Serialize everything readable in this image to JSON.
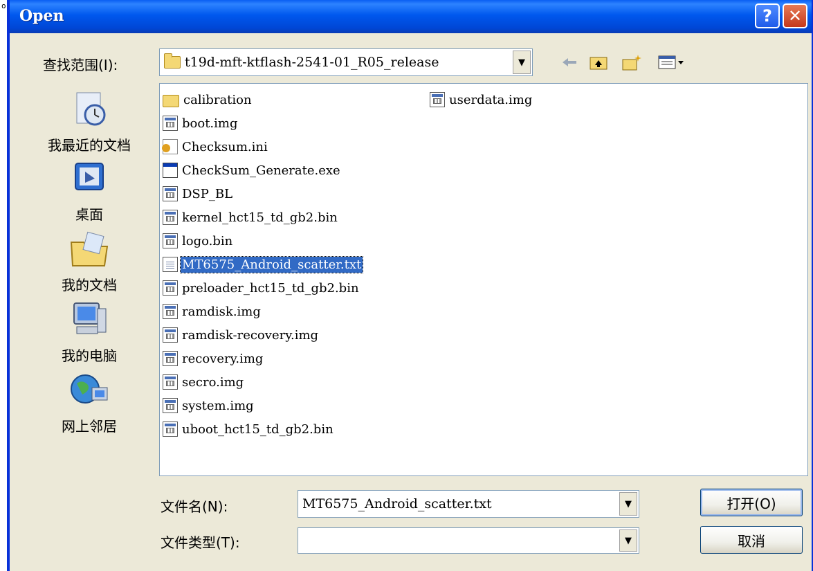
{
  "window": {
    "title": "Open",
    "help_glyph": "?",
    "close_glyph": "✕"
  },
  "lookin": {
    "label": "查找范围(I):",
    "value": "t19d-mft-ktflash-2541-01_R05_release"
  },
  "toolbar": {
    "back": "back-icon",
    "up": "up-folder-icon",
    "new": "new-folder-icon",
    "views": "views-menu-icon"
  },
  "places": [
    {
      "label": "我最近的文档",
      "icon": "recent-documents-icon"
    },
    {
      "label": "桌面",
      "icon": "desktop-icon"
    },
    {
      "label": "我的文档",
      "icon": "my-documents-icon"
    },
    {
      "label": "我的电脑",
      "icon": "my-computer-icon"
    },
    {
      "label": "网上邻居",
      "icon": "network-places-icon"
    }
  ],
  "files": [
    {
      "name": "calibration",
      "type": "folder"
    },
    {
      "name": "boot.img",
      "type": "img"
    },
    {
      "name": "Checksum.ini",
      "type": "ini"
    },
    {
      "name": "CheckSum_Generate.exe",
      "type": "exe"
    },
    {
      "name": "DSP_BL",
      "type": "img"
    },
    {
      "name": "kernel_hct15_td_gb2.bin",
      "type": "img"
    },
    {
      "name": "logo.bin",
      "type": "img"
    },
    {
      "name": "MT6575_Android_scatter.txt",
      "type": "txt",
      "selected": true
    },
    {
      "name": "preloader_hct15_td_gb2.bin",
      "type": "img"
    },
    {
      "name": "ramdisk.img",
      "type": "img"
    },
    {
      "name": "ramdisk-recovery.img",
      "type": "img"
    },
    {
      "name": "recovery.img",
      "type": "img"
    },
    {
      "name": "secro.img",
      "type": "img"
    },
    {
      "name": "system.img",
      "type": "img"
    },
    {
      "name": "uboot_hct15_td_gb2.bin",
      "type": "img"
    },
    {
      "name": "userdata.img",
      "type": "img"
    }
  ],
  "filename": {
    "label": "文件名(N):",
    "value": "MT6575_Android_scatter.txt"
  },
  "filetype": {
    "label": "文件类型(T):",
    "value": ""
  },
  "buttons": {
    "open": "打开(O)",
    "cancel": "取消"
  },
  "dropdown_glyph": "▼"
}
